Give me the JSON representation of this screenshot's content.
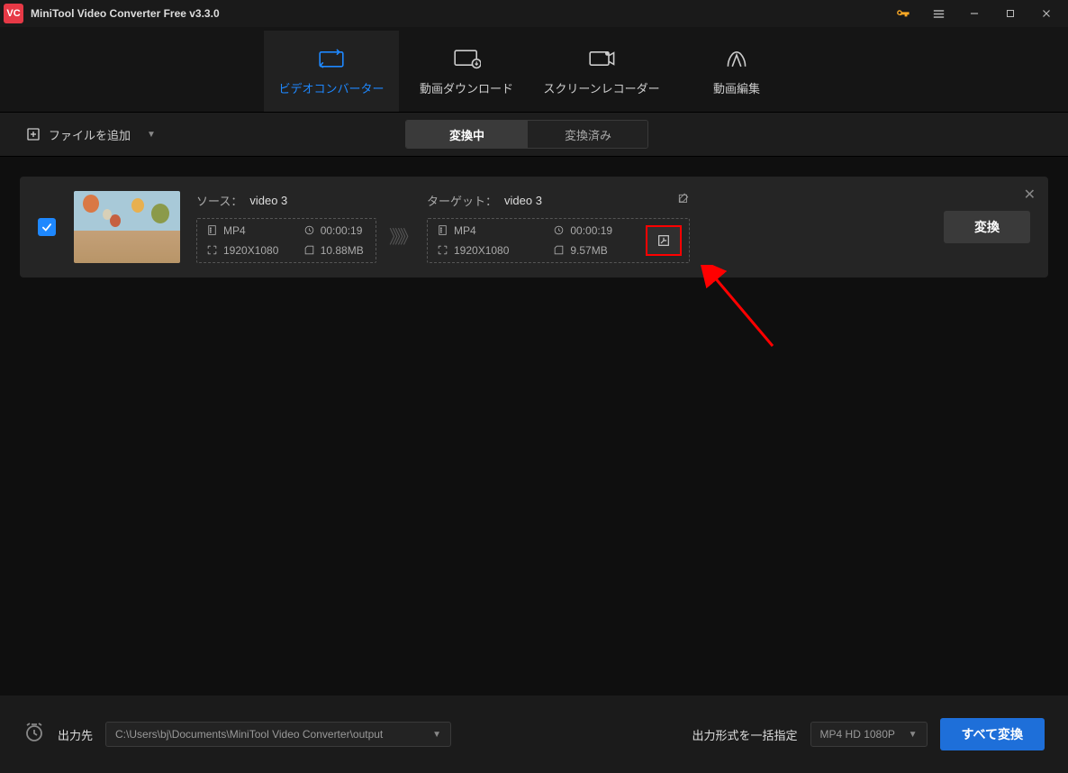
{
  "app": {
    "title": "MiniTool Video Converter Free v3.3.0",
    "logo_text": "VC"
  },
  "nav": {
    "converter": "ビデオコンバーター",
    "download": "動画ダウンロード",
    "recorder": "スクリーンレコーダー",
    "edit": "動画編集"
  },
  "toolbar": {
    "add_file": "ファイルを追加",
    "tab_converting": "変換中",
    "tab_converted": "変換済み"
  },
  "item": {
    "source_label": "ソース：",
    "source_name": "video 3",
    "target_label": "ターゲット：",
    "target_name": "video 3",
    "src": {
      "format": "MP4",
      "duration": "00:00:19",
      "resolution": "1920X1080",
      "size": "10.88MB"
    },
    "tgt": {
      "format": "MP4",
      "duration": "00:00:19",
      "resolution": "1920X1080",
      "size": "9.57MB"
    },
    "convert_btn": "変換",
    "arrows": "》》》"
  },
  "footer": {
    "output_label": "出力先",
    "output_path": "C:\\Users\\bj\\Documents\\MiniTool Video Converter\\output",
    "format_label": "出力形式を一括指定",
    "format_value": "MP4 HD 1080P",
    "convert_all": "すべて変換"
  }
}
